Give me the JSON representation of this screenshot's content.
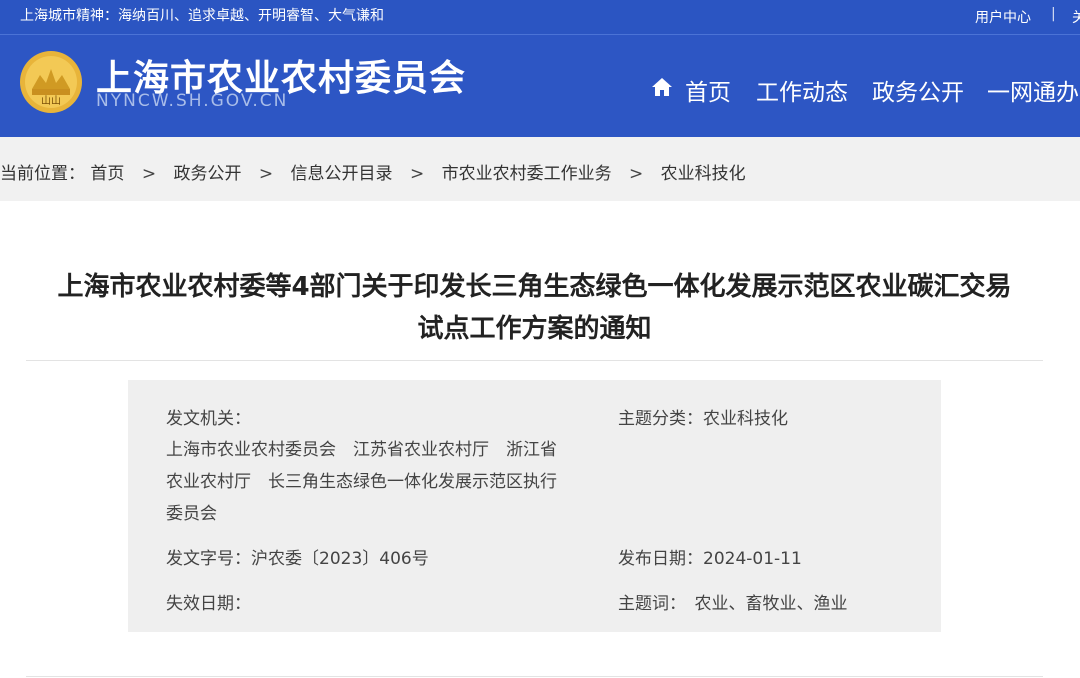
{
  "topbar": {
    "motto": "上海城市精神：海纳百川、追求卓越、开明睿智、大气谦和",
    "user_center": "用户中心",
    "separator": "|",
    "cut_off_link": "关"
  },
  "header": {
    "site_title": "上海市农业农村委员会",
    "site_domain": "NYNCW.SH.GOV.CN",
    "logo_text": "山山",
    "nav": [
      {
        "label": "首页",
        "icon": "home-icon"
      },
      {
        "label": "工作动态"
      },
      {
        "label": "政务公开"
      },
      {
        "label": "一网通办"
      }
    ]
  },
  "breadcrumb": {
    "prefix": "当前位置：",
    "items": [
      "首页",
      "政务公开",
      "信息公开目录",
      "市农业农村委工作业务",
      "农业科技化"
    ],
    "separator": ">"
  },
  "article": {
    "title_line1": "上海市农业农村委等4部门关于印发长三角生态绿色一体化发展示范区农业碳汇交易",
    "title_line2": "试点工作方案的通知"
  },
  "meta": {
    "issuer_label": "发文机关：",
    "issuer_lines": [
      "上海市农业农村委员会　江苏省农业农村厅　浙江省",
      "农业农村厅　长三角生态绿色一体化发展示范区执行",
      "委员会"
    ],
    "topic": "主题分类：农业科技化",
    "doc_number": "发文字号：沪农委〔2023〕406号",
    "publish_date": "发布日期：2024-01-11",
    "expiry": "失效日期：",
    "keywords": "主题词：　农业、畜牧业、渔业"
  },
  "colors": {
    "header_blue": "#2d56c4",
    "topbar_blue": "#2b55c2",
    "logo_gold": "#e8b43a",
    "breadcrumb_bg": "#f1f1f1",
    "meta_bg": "#efefef"
  }
}
